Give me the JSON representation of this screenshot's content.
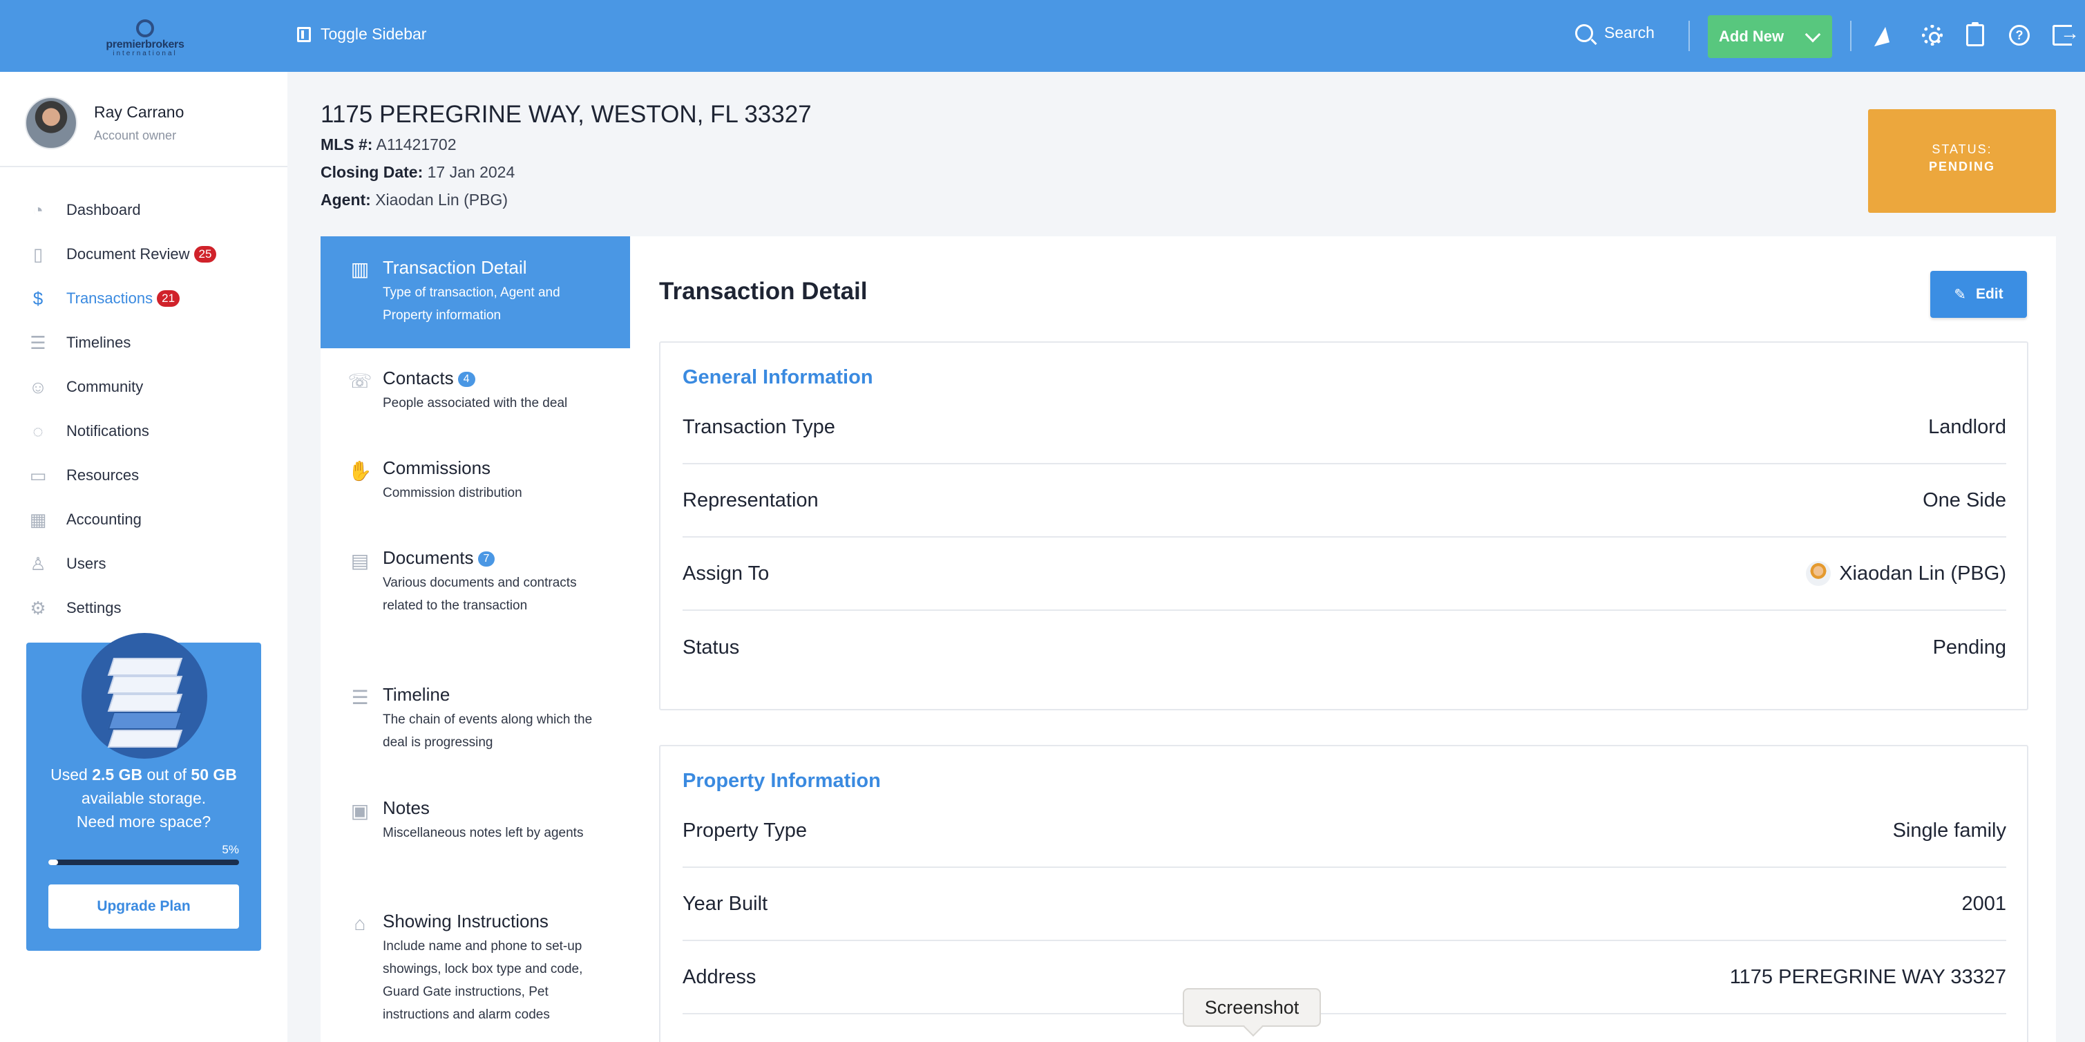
{
  "topbar": {
    "logo": {
      "word": "premierbrokers",
      "sub": "international"
    },
    "toggle_label": "Toggle Sidebar",
    "search_label": "Search",
    "add_new_label": "Add New"
  },
  "user": {
    "name": "Ray Carrano",
    "role": "Account owner"
  },
  "nav": {
    "items": [
      {
        "label": "Dashboard",
        "icon": "gauge-icon"
      },
      {
        "label": "Document Review",
        "icon": "document-check-icon",
        "badge": "25"
      },
      {
        "label": "Transactions",
        "icon": "dollar-circle-icon",
        "badge": "21"
      },
      {
        "label": "Timelines",
        "icon": "timeline-icon"
      },
      {
        "label": "Community",
        "icon": "people-icon"
      },
      {
        "label": "Notifications",
        "icon": "chat-bubble-icon"
      },
      {
        "label": "Resources",
        "icon": "folder-icon"
      },
      {
        "label": "Accounting",
        "icon": "calculator-icon"
      },
      {
        "label": "Users",
        "icon": "user-icon"
      },
      {
        "label": "Settings",
        "icon": "gear-icon"
      }
    ]
  },
  "storage": {
    "used_prefix": "Used",
    "used": "2.5 GB",
    "out_of": "out of",
    "total": "50 GB",
    "line2": "available storage.",
    "line3": "Need more space?",
    "percent_label": "5%",
    "percent_value": 5,
    "upgrade_label": "Upgrade Plan"
  },
  "header": {
    "address": "1175 PEREGRINE WAY, WESTON, FL 33327",
    "mls_label": "MLS #:",
    "mls_value": "A11421702",
    "closing_label": "Closing Date:",
    "closing_value": "17 Jan 2024",
    "agent_label": "Agent:",
    "agent_value": "Xiaodan Lin (PBG)",
    "status_label": "STATUS:",
    "status_value": "PENDING"
  },
  "tabs": [
    {
      "title": "Transaction Detail",
      "desc": "Type of transaction, Agent and Property information",
      "icon": "building-icon"
    },
    {
      "title": "Contacts",
      "desc": "People associated with the deal",
      "badge": "4",
      "icon": "phone-book-icon"
    },
    {
      "title": "Commissions",
      "desc": "Commission distribution",
      "icon": "hand-coin-icon"
    },
    {
      "title": "Documents",
      "desc": "Various documents and contracts related to the transaction",
      "badge": "7",
      "icon": "document-icon"
    },
    {
      "title": "Timeline",
      "desc": "The chain of events along which the deal is progressing",
      "icon": "timeline-icon"
    },
    {
      "title": "Notes",
      "desc": "Miscellaneous notes left by agents",
      "icon": "note-icon"
    },
    {
      "title": "Showing Instructions",
      "desc": "Include name and phone to set-up showings, lock box type and code, Guard Gate instructions, Pet instructions and alarm codes",
      "icon": "house-icon"
    }
  ],
  "panel": {
    "title": "Transaction Detail",
    "edit_label": "Edit",
    "general": {
      "title": "General Information",
      "rows": [
        {
          "key": "Transaction Type",
          "value": "Landlord"
        },
        {
          "key": "Representation",
          "value": "One Side"
        },
        {
          "key": "Assign To",
          "value": "Xiaodan Lin (PBG)"
        },
        {
          "key": "Status",
          "value": "Pending"
        }
      ]
    },
    "property": {
      "title": "Property Information",
      "rows": [
        {
          "key": "Property Type",
          "value": "Single family"
        },
        {
          "key": "Year Built",
          "value": "2001"
        },
        {
          "key": "Address",
          "value": "1175 PEREGRINE WAY 33327"
        }
      ]
    }
  },
  "tooltip": "Screenshot",
  "colors": {
    "primary": "#4a97e4",
    "success": "#58c77e",
    "warning": "#eca73d",
    "danger": "#d0222a"
  }
}
